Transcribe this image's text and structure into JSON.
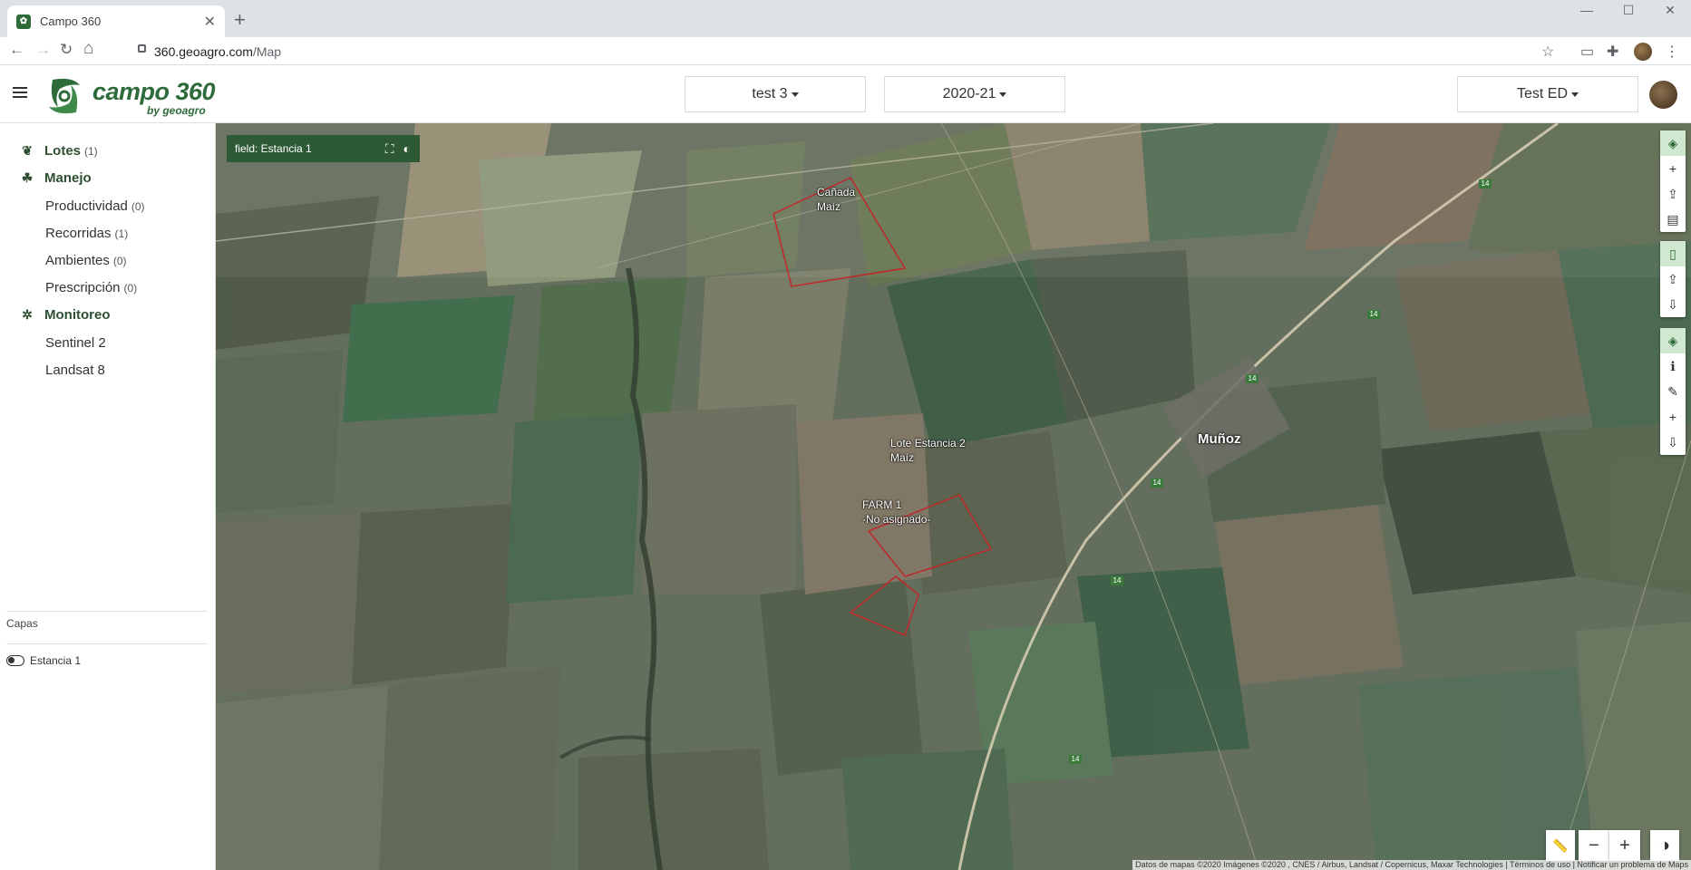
{
  "browser": {
    "tab_title": "Campo 360",
    "new_tab": "+",
    "url_host": "360.geoagro.com",
    "url_path": "/Map",
    "win_min": "—",
    "win_max": "☐",
    "win_close": "✕"
  },
  "header": {
    "logo_text": "campo 360",
    "logo_sub": "by geoagro",
    "farm_select": "test 3",
    "season_select": "2020-21",
    "user_select": "Test ED"
  },
  "sidebar": {
    "lotes": {
      "label": "Lotes",
      "count": "(1)"
    },
    "manejo": {
      "label": "Manejo"
    },
    "productividad": {
      "label": "Productividad",
      "count": "(0)"
    },
    "recorridas": {
      "label": "Recorridas",
      "count": "(1)"
    },
    "ambientes": {
      "label": "Ambientes",
      "count": "(0)"
    },
    "prescripcion": {
      "label": "Prescripción",
      "count": "(0)"
    },
    "monitoreo": {
      "label": "Monitoreo"
    },
    "sentinel": {
      "label": "Sentinel 2"
    },
    "landsat": {
      "label": "Landsat 8"
    },
    "capas_label": "Capas",
    "layer_name": "Estancia 1"
  },
  "map": {
    "field_bar_label": "field: Estancia 1",
    "labels": {
      "canada_name": "Cañada",
      "canada_crop": "Maíz",
      "lote2_name": "Lote Estancia 2",
      "lote2_crop": "Maíz",
      "farm1_name": "FARM 1",
      "farm1_crop": "-No asignado-"
    },
    "town": "Muñoz",
    "route": "14",
    "attribution": "Datos de mapas ©2020 Imágenes ©2020 , CNES / Airbus, Landsat / Copernicus, Maxar Technologies  |  Términos de uso  |  Notificar un problema de Maps"
  }
}
